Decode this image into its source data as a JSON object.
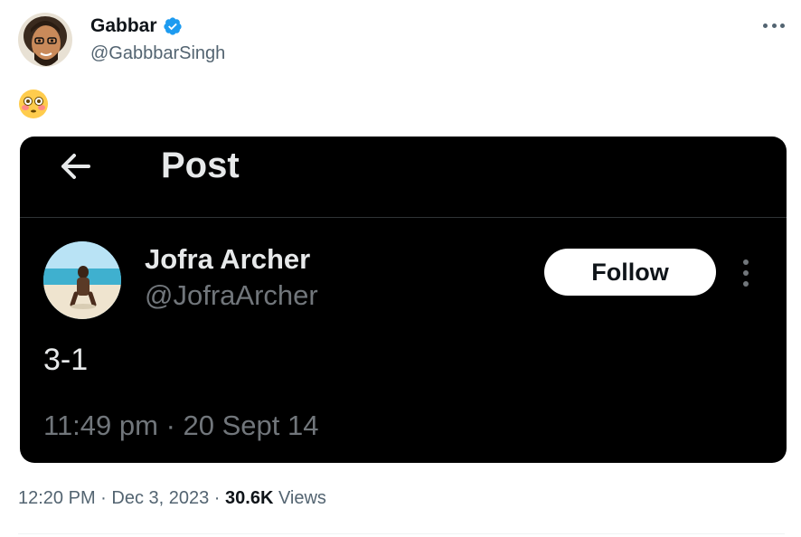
{
  "tweet": {
    "author_name": "Gabbar",
    "author_handle": "@GabbbarSingh",
    "verified_icon": "verified-badge-icon",
    "verified_color": "#1d9bf0",
    "body_emoji": "😳",
    "timestamp": "12:20 PM · Dec 3, 2023 · ",
    "views_count": "30.6K",
    "views_label": " Views"
  },
  "embedded_post": {
    "header_title": "Post",
    "author_name": "Jofra Archer",
    "author_handle": "@JofraArcher",
    "follow_label": "Follow",
    "text": "3-1",
    "timestamp": "11:49 pm · 20 Sept 14",
    "background": "#000000"
  }
}
